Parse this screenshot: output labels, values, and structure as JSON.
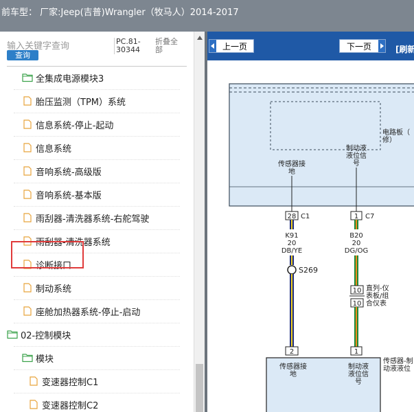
{
  "title_bar": {
    "text": "前车型：  厂家:Jeep(吉普)Wrangler（牧马人）2014-2017"
  },
  "left_panel": {
    "search_placeholder": "输入关键字查询",
    "query_button": "查询",
    "pc_code": "PC.81-30344",
    "collapse_all": "折叠全部",
    "tree": [
      {
        "label": "全集成电源模块3",
        "icon": "folder-open-icon"
      },
      {
        "label": "胎压监测（TPM）系统",
        "icon": "document-icon"
      },
      {
        "label": "信息系统-停止-起动",
        "icon": "document-icon"
      },
      {
        "label": "信息系统",
        "icon": "document-icon"
      },
      {
        "label": "音响系统-高级版",
        "icon": "document-icon"
      },
      {
        "label": "音响系统-基本版",
        "icon": "document-icon"
      },
      {
        "label": "雨刮器-清洗器系统-右舵驾驶",
        "icon": "document-icon"
      },
      {
        "label": "雨刮器-清洗器系统",
        "icon": "document-icon"
      },
      {
        "label": "诊断接口",
        "icon": "document-icon"
      },
      {
        "label": "制动系统",
        "icon": "document-icon",
        "selected": true
      },
      {
        "label": "座舱加热器系统-停止-启动",
        "icon": "document-icon"
      },
      {
        "label": "02-控制模块",
        "icon": "folder-open-icon"
      },
      {
        "label": "模块",
        "icon": "folder-open-icon"
      },
      {
        "label": "变速器控制C1",
        "icon": "document-icon"
      },
      {
        "label": "变速器控制C2",
        "icon": "document-icon"
      }
    ]
  },
  "right_panel": {
    "prev_button": "上一页",
    "next_button": "下一页",
    "refresh_link": "[刷新"
  },
  "diagram": {
    "top_module_label_1": "电路板（",
    "top_module_label_2": "修）",
    "sensor_ground_1": "传感器接",
    "sensor_ground_2": "地",
    "brake_fluid_1": "制动液",
    "brake_fluid_2": "液位信",
    "brake_fluid_3": "号",
    "connector_c1_pin": "28",
    "connector_c1": "C1",
    "connector_c7_pin": "1",
    "connector_c7": "C7",
    "wire1_circuit": "K91",
    "wire1_gauge": "20",
    "wire1_color": "DB/YE",
    "wire2_circuit": "B20",
    "wire2_gauge": "20",
    "wire2_color": "DG/OG",
    "splice": "S269",
    "inline_pin_1": "10",
    "inline_pin_2": "10",
    "inline_label_1": "直列-仪",
    "inline_label_2": "表板/组",
    "inline_label_3": "合仪表",
    "bottom_pin_1": "2",
    "bottom_pin_2": "1",
    "bottom_sensor_ground_1": "传感器接",
    "bottom_sensor_ground_2": "地",
    "bottom_brake_fluid_1": "制动液",
    "bottom_brake_fluid_2": "液位信",
    "bottom_brake_fluid_3": "号",
    "side_label_1": "传感器-制",
    "side_label_2": "动液液位",
    "colors": {
      "module_fill": "#dbe9f6",
      "wire1_stripe": "#f2d21b",
      "wire1_base": "#1c2a80",
      "wire2_stripe": "#f08a1c",
      "wire2_base": "#1e8a3a"
    }
  }
}
